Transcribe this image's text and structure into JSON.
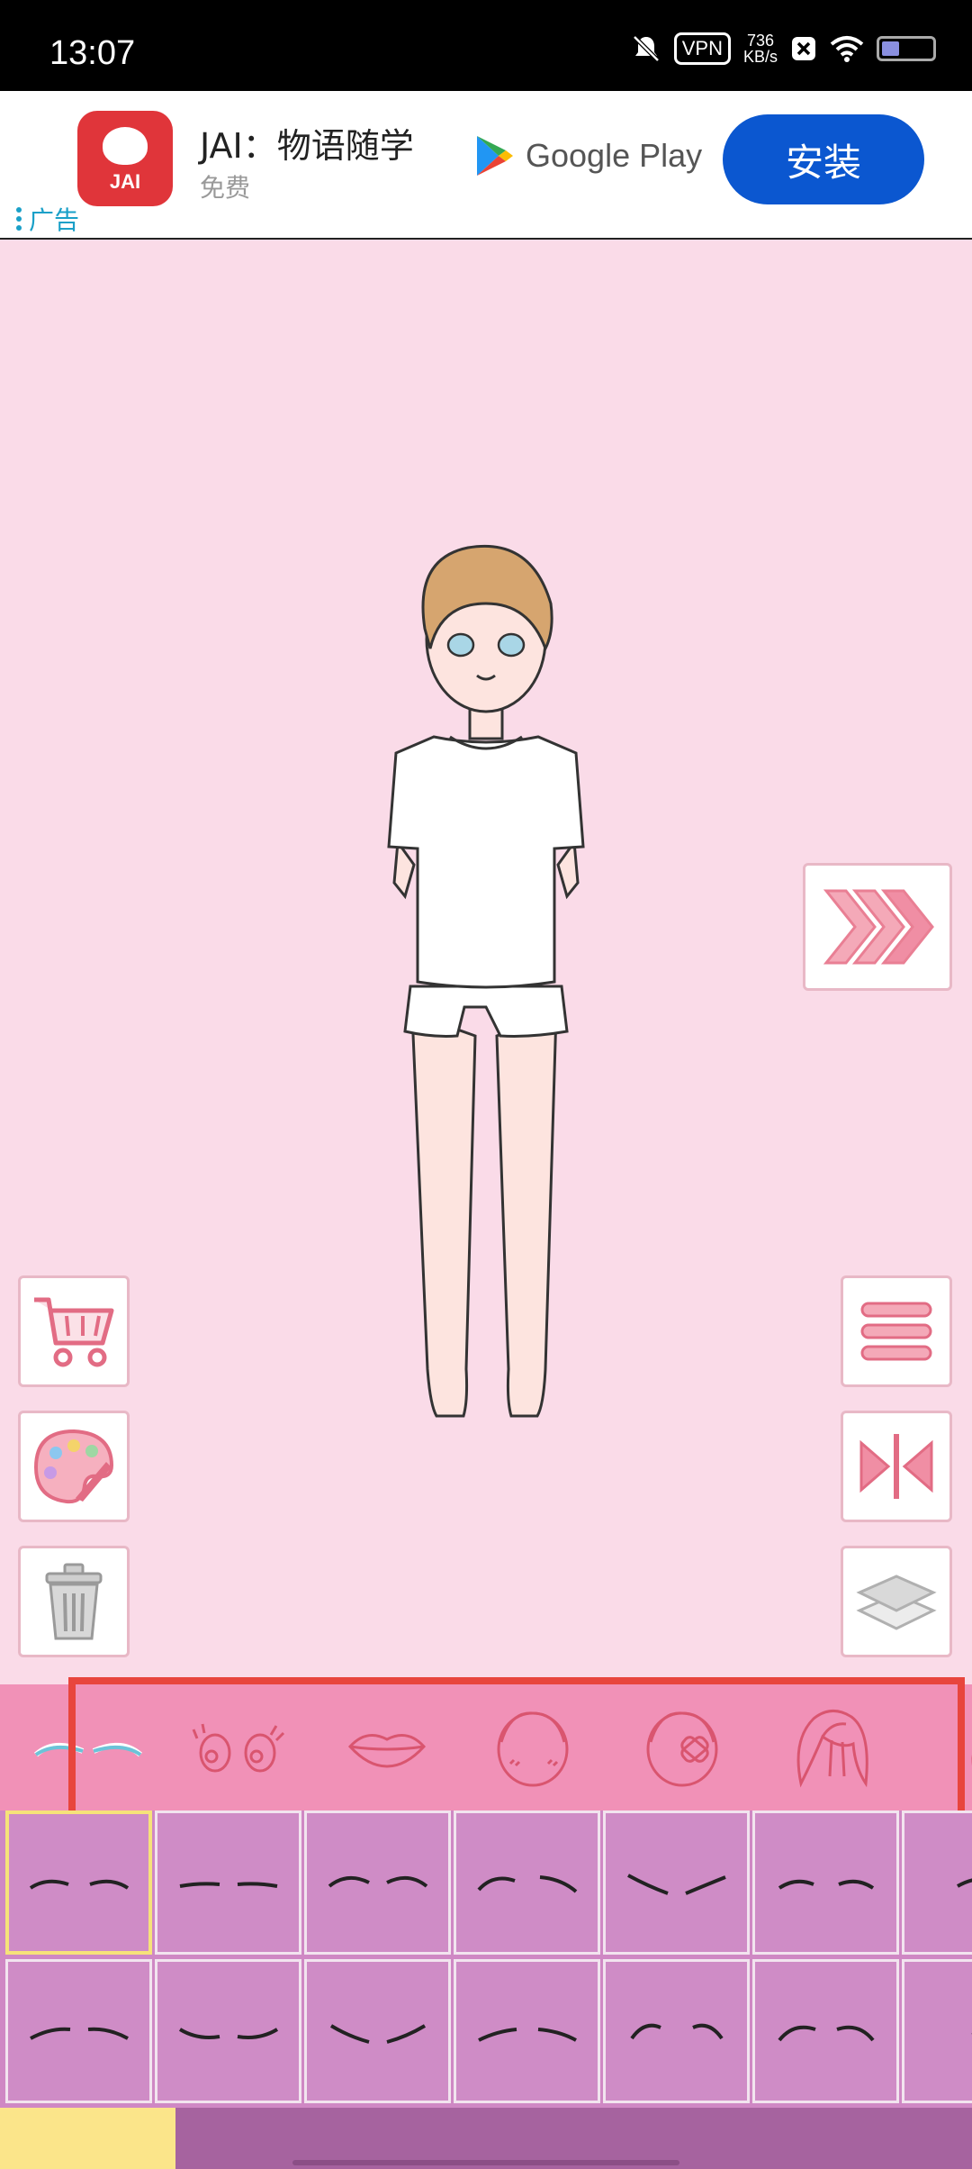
{
  "status_bar": {
    "time": "13:07",
    "vpn": "VPN",
    "speed_value": "736",
    "speed_unit": "KB/s",
    "battery_level": 0.35
  },
  "ad": {
    "app_name": "JAI：物语随学",
    "app_icon_text": "JAI",
    "price": "免费",
    "store": "Google Play",
    "install_label": "安装",
    "ad_label": "广告"
  },
  "canvas": {
    "character": "boy-in-white-tshirt-and-shorts"
  },
  "side_buttons": {
    "next": "next-arrows-icon",
    "shop": "cart-icon",
    "palette": "palette-icon",
    "trash": "trash-icon",
    "menu": "menu-icon",
    "flip": "flip-icon",
    "layers": "layers-icon"
  },
  "categories": [
    "eyebrows-icon",
    "eyes-icon",
    "lips-icon",
    "face-blush-icon",
    "face-bandage-icon",
    "hair-icon",
    "hair-partial-icon"
  ],
  "grid": {
    "rows": 2,
    "columns_visible": 7,
    "selected_index": 0
  },
  "colors": {
    "background": "#fadbe8",
    "category_bar": "#f191b7",
    "grid": "#cf88c4",
    "accent": "#e8453d",
    "install": "#0b57d0"
  }
}
